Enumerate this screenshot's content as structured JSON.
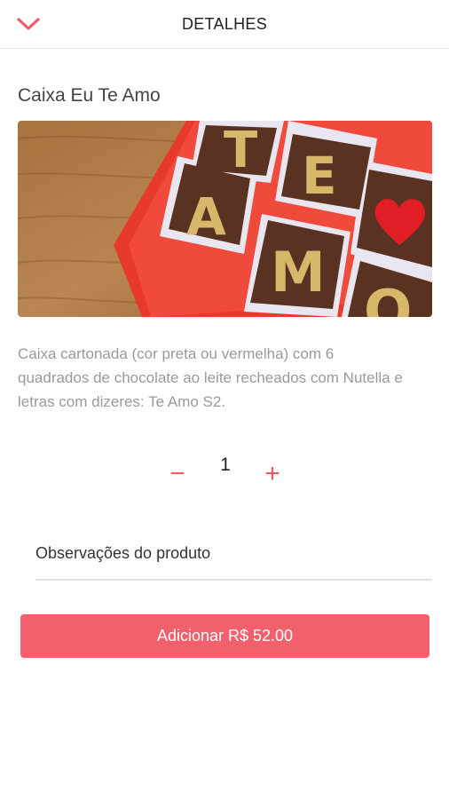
{
  "header": {
    "title": "DETALHES",
    "back_icon": "chevron-down-icon"
  },
  "product": {
    "name": "Caixa Eu Te Amo",
    "description": "Caixa cartonada (cor preta ou vermelha) com 6 quadrados de chocolate ao leite recheados com Nutella e letras com dizeres: Te Amo S2.",
    "image_letters": [
      "T",
      "E",
      "A",
      "M",
      "O"
    ]
  },
  "quantity": {
    "minus_label": "−",
    "value": "1",
    "plus_label": "+"
  },
  "notes": {
    "placeholder": "Observações do produto"
  },
  "add_button": {
    "label": "Adicionar R$ 52.00"
  },
  "colors": {
    "accent": "#f1606c",
    "text": "#222222",
    "muted": "#9a9a9a"
  }
}
